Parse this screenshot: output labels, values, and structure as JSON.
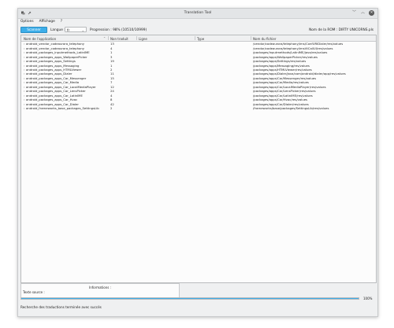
{
  "window": {
    "title": "Translation Tool"
  },
  "menu": {
    "items": [
      "Options",
      "Affichage",
      "?"
    ]
  },
  "toolbar": {
    "scan_label": "Scanner",
    "language_label": "Langue :",
    "language_value": "fr",
    "progress_label": "Progression : 98% (10510/10999)",
    "rom_label": "Nom de la ROM : DIRTY UNICORNS.pls"
  },
  "table": {
    "headers": [
      "Nom de l'application",
      "Non traduit",
      "Ligne",
      "Type",
      "Nom du fichier"
    ],
    "rows": [
      [
        "android_vendor_codeaurora_telephony",
        "13",
        "/vendor/codeaurora/telephony/ims/ConfURIDialer/res/values"
      ],
      [
        "android_vendor_codeaurora_telephony",
        "4",
        "/vendor/codeaurora/telephony/imsVtCallUI/res/values"
      ],
      [
        "android_packages_inputmethods_LatinIME",
        "1",
        "/packages/inputmethods/LatinIME/java/res/values"
      ],
      [
        "android_packages_apps_WallpaperPicker",
        "3",
        "/packages/apps/WallpaperPicker/res/values"
      ],
      [
        "android_packages_apps_Settings",
        "19",
        "/packages/apps/Settings/res/values"
      ],
      [
        "android_packages_apps_Messaging",
        "1",
        "/packages/apps/Messaging/res/values"
      ],
      [
        "android_packages_apps_HTMLViewer",
        "2",
        "/packages/apps/HTMLViewer/res/values"
      ],
      [
        "android_packages_apps_Dialer",
        "11",
        "/packages/apps/Dialer/java/com/android/dialer/app/res/values"
      ],
      [
        "android_packages_apps_Car_Messenger",
        "15",
        "/packages/apps/Car/Messenger/res/values"
      ],
      [
        "android_packages_apps_Car_Media",
        "7",
        "/packages/apps/Car/Media/res/values"
      ],
      [
        "android_packages_apps_Car_LocalMediaPlayer",
        "12",
        "/packages/apps/Car/LocalMediaPlayer/res/values"
      ],
      [
        "android_packages_apps_Car_LensPicker",
        "24",
        "/packages/apps/Car/LensPicker/res/values"
      ],
      [
        "android_packages_apps_Car_LatinIME",
        "4",
        "/packages/apps/Car/LatinIME/res/values"
      ],
      [
        "android_packages_apps_Car_Hvac",
        "8",
        "/packages/apps/Car/Hvac/res/values"
      ],
      [
        "android_packages_apps_Car_Dialer",
        "42",
        "/packages/apps/Car/Dialer/res/values"
      ],
      [
        "android_frameworks_base_packages_SettingsLib",
        "2",
        "/frameworks/base/packages/SettingsLib/res/values"
      ]
    ]
  },
  "info": {
    "title": "Informations :",
    "source_label": "Texte source :"
  },
  "progress": {
    "value": 1.0,
    "label": "100%"
  },
  "status": {
    "message": "Recherche des traductions terminée avec succès"
  },
  "colors": {
    "accent": "#3daee9",
    "window_bg": "#eff0f1",
    "table_bg": "#fcfcfc"
  }
}
